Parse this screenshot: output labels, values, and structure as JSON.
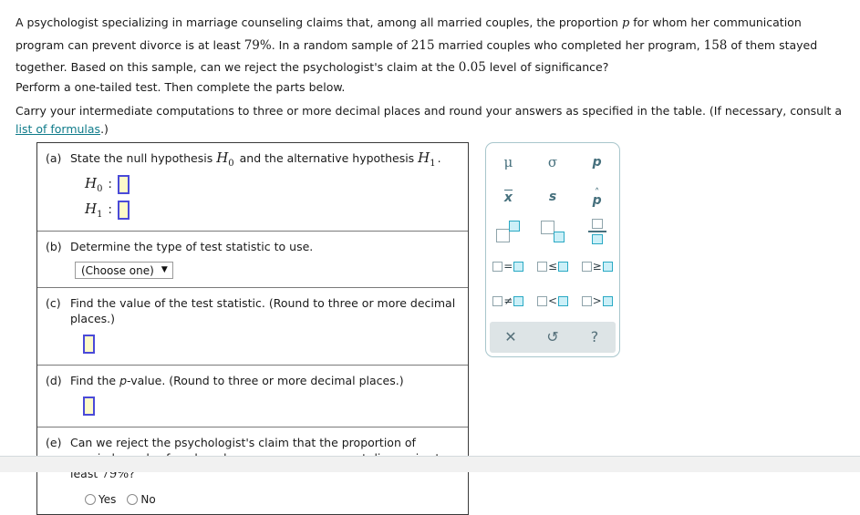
{
  "problem": {
    "line1_a": "A psychologist specializing in marriage counseling claims that, among all married couples, the proportion ",
    "line1_var": "p",
    "line1_b": " for whom her communication program can prevent divorce is at least ",
    "pct_79": "79%",
    "line2_a": ". In a random sample of ",
    "n": "215",
    "line2_b": " married couples who completed her program, ",
    "x": "158",
    "line2_c": " of them stayed together. Based on this sample, can we reject the psychologist's claim at the ",
    "alpha": "0.05",
    "line3_end": " level of significance?"
  },
  "instructions": {
    "one_tailed": "Perform a one-tailed test. Then complete the parts below.",
    "rounding_a": "Carry your intermediate computations to three or more decimal places and round your answers as specified in the table. (If necessary, consult a ",
    "link_text": "list of formulas",
    "rounding_b": ".)",
    "link_color": "#0f7b8a"
  },
  "questions": {
    "a": {
      "label": "(a)",
      "text_a": "State the null hypothesis ",
      "h0": "H",
      "h0_sub": "0",
      "text_b": " and the alternative hypothesis ",
      "h1": "H",
      "h1_sub": "1",
      "text_c": ".",
      "row_h0_sym": "H",
      "row_h0_sub": "0",
      "row_h1_sym": "H",
      "row_h1_sub": "1",
      "colon": ":",
      "input_value": ""
    },
    "b": {
      "label": "(b)",
      "text": "Determine the type of test statistic to use.",
      "select_value": "(Choose one)",
      "caret": "▼"
    },
    "c": {
      "label": "(c)",
      "text": "Find the value of the test statistic. (Round to three or more decimal places.)",
      "input_value": ""
    },
    "d": {
      "label": "(d)",
      "text_a": "Find the ",
      "pvar": "p",
      "text_b": "-value. (Round to three or more decimal places.)",
      "input_value": ""
    },
    "e": {
      "label": "(e)",
      "text_a": "Can we reject the psychologist's claim that the proportion of married couples for whom her program can prevent divorce is at least ",
      "pct": "79%",
      "text_b": "?",
      "option_yes": "Yes",
      "option_no": "No"
    }
  },
  "palette": {
    "accent_color": "#46707d",
    "cyan_color": "#2aa9c4",
    "rows": [
      {
        "cells": [
          {
            "name": "mu",
            "glyph": "μ"
          },
          {
            "name": "sigma",
            "glyph": "σ"
          },
          {
            "name": "p",
            "glyph": "p"
          }
        ]
      },
      {
        "cells": [
          {
            "name": "x-bar",
            "glyph": "x"
          },
          {
            "name": "s",
            "glyph": "s"
          },
          {
            "name": "p-hat",
            "glyph": "p",
            "hat": "˄"
          }
        ]
      },
      {
        "cells": [
          {
            "name": "superscript",
            "glyph": ""
          },
          {
            "name": "subscript",
            "glyph": ""
          },
          {
            "name": "fraction",
            "glyph": ""
          }
        ]
      },
      {
        "cells": [
          {
            "name": "equals",
            "op": "="
          },
          {
            "name": "less-than-or-equal",
            "op": "≤"
          },
          {
            "name": "greater-than-or-equal",
            "op": "≥"
          }
        ]
      },
      {
        "cells": [
          {
            "name": "not-equal",
            "op": "≠"
          },
          {
            "name": "less-than",
            "op": "<"
          },
          {
            "name": "greater-than",
            "op": ">"
          }
        ]
      }
    ],
    "bar": [
      {
        "name": "clear",
        "glyph": "✕"
      },
      {
        "name": "undo",
        "glyph": "↺"
      },
      {
        "name": "help",
        "glyph": "?"
      }
    ]
  }
}
